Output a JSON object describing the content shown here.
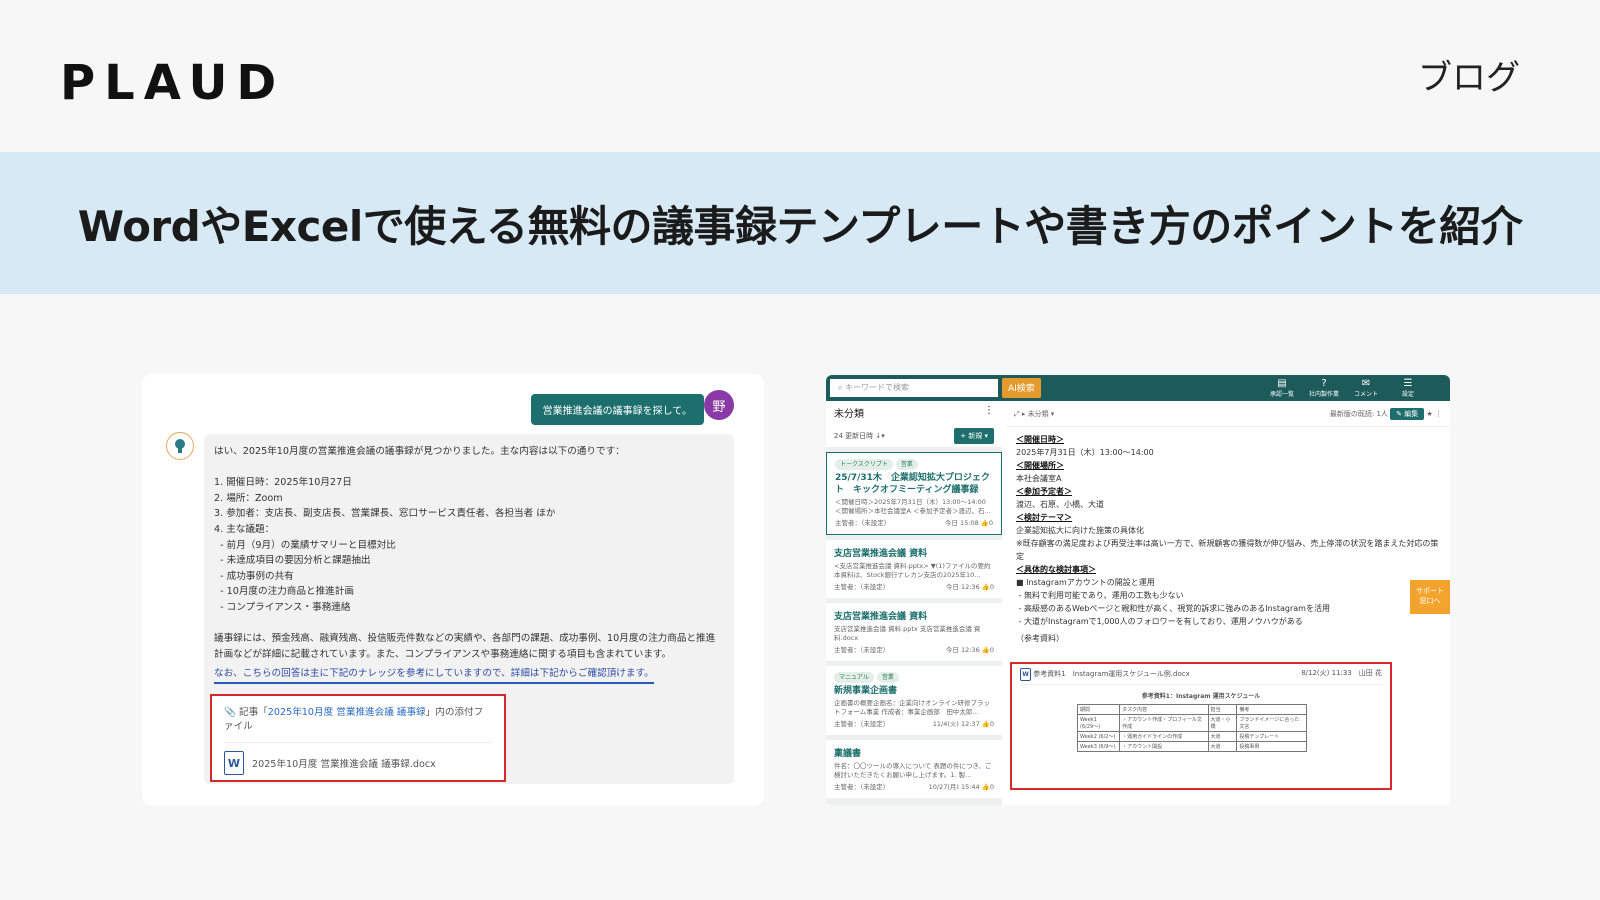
{
  "header": {
    "logo": "PLAUD",
    "nav_blog": "ブログ"
  },
  "banner": {
    "title": "WordやExcelで使える無料の議事録テンプレートや書き方のポイントを紹介"
  },
  "chat": {
    "user_message": "営業推進会議の議事録を探して。",
    "user_avatar": "野",
    "answer_text": "はい、2025年10月度の営業推進会議の議事録が見つかりました。主な内容は以下の通りです：\n\n1. 開催日時：2025年10月27日\n2. 場所：Zoom\n3. 参加者：支店長、副支店長、営業課長、窓口サービス責任者、各担当者 ほか\n4. 主な議題：\n  - 前月（9月）の業績サマリーと目標対比\n  - 未達成項目の要因分析と課題抽出\n  - 成功事例の共有\n  - 10月度の注力商品と推進計画\n  - コンプライアンス・事務連絡\n\n議事録には、預金残高、融資残高、投信販売件数などの実績や、各部門の課題、成功事例、10月度の注力商品と推進計画などが詳細に記載されています。また、コンプライアンスや事務連絡に関する項目も含まれています。",
    "note": "なお、こちらの回答は主に下記のナレッジを参考にしていますので、詳細は下記からご確認頂けます。",
    "attach_prefix": "記事「",
    "attach_link": "2025年10月度 営業推進会議 議事録",
    "attach_suffix": "」内の添付ファイル",
    "file_name": "2025年10月度 営業推進会議 議事録.docx",
    "word_icon": "W"
  },
  "app": {
    "search_placeholder": "キーワードで検索",
    "ai_search": "AI検索",
    "top_icons": [
      {
        "g": "▤",
        "l": "承認一覧"
      },
      {
        "g": "?",
        "l": "社内製作業"
      },
      {
        "g": "✉",
        "l": "コメント"
      },
      {
        "g": "☰",
        "l": "設定"
      }
    ],
    "list_title": "未分類",
    "list_count": "24  更新日時 ↓▾",
    "new_button": "+ 新規 ▾",
    "cards": [
      {
        "tags": [
          "トークスクリプト",
          "営業"
        ],
        "title": "25/7/31木　企業認知拡大プロジェクト　キックオフミーティング議事録",
        "desc": "＜開催日時＞2025年7月31日（木）13:00〜14:00 ＜開催場所＞本社会議室A ＜参加予定者＞渡辺、石…",
        "owner": "主管者：（未設定）",
        "date": "今日 15:08 👍0"
      },
      {
        "tags": [],
        "title": "支店営業推進会議 資料",
        "desc": "<支店営業推進会議 資料.pptx> ▼(1)ファイルの要約 本資料は、Stock銀行ナレカン支店の2025年10…",
        "owner": "主管者：（未設定）",
        "date": "今日 12:36 👍0"
      },
      {
        "tags": [],
        "title": "支店営業推進会議 資料",
        "desc": "支店営業推進会議 資料.pptx 支店営業推進会議 資料.docx",
        "owner": "主管者：（未設定）",
        "date": "今日 12:36 👍0"
      },
      {
        "tags": [
          "マニュアル",
          "営業"
        ],
        "title": "新規事業企画書",
        "desc": "企画書の概要企画名：企業向けオンライン研修プラットフォーム事業 作成者：事業企画部　田中太郎…",
        "owner": "主管者：（未設定）",
        "date": "11/4(火) 12:37 👍0"
      },
      {
        "tags": [],
        "title": "稟議書",
        "desc": "件名：〇〇ツールの導入について 表題の件につき、ご検討いただきたくお願い申し上げます。1. 製…",
        "owner": "主管者：（未設定）",
        "date": "10/27(月) 15:44 👍0"
      }
    ],
    "detail_folder": "▸ 未分類 ▾",
    "detail_reader": "最新版の既読: 1人",
    "edit_button": "✎ 編集",
    "detail_body": [
      {
        "h": "＜開催日時＞",
        "t": "2025年7月31日（木）13:00〜14:00"
      },
      {
        "h": "＜開催場所＞",
        "t": "本社会議室A"
      },
      {
        "h": "＜参加予定者＞",
        "t": "渡辺、石原、小橋、大道"
      },
      {
        "h": "＜検討テーマ＞",
        "t": "企業認知拡大に向けた施策の具体化\n※既存顧客の満足度および再受注率は高い一方で、新規顧客の獲得数が伸び悩み、売上停滞の状況を踏まえた対応の策定"
      },
      {
        "h": "＜具体的な検討事項＞",
        "t": "■ Instagramアカウントの開設と運用\n - 無料で利用可能であり、運用の工数も少ない\n - 高級感のあるWebページと親和性が高く、視覚的訴求に強みのあるInstagramを活用\n - 大道がInstagramで1,000人のフォロワーを有しており、運用ノウハウがある"
      }
    ],
    "ref_label": "（参考資料）",
    "support": "サポート\n窓口へ",
    "ref_file": "参考資料1　Instagram運用スケジュール例.docx",
    "ref_date": "8/12(火) 11:33　山田 花",
    "mini_title": "参考資料1：Instagram 運用スケジュール",
    "mini_rows": [
      [
        "期間",
        "タスク内容",
        "担当",
        "備考"
      ],
      [
        "Week1\n(6/29〜)",
        "・アカウント作成・プロフィール文作成",
        "大道・小橋",
        "ブランドイメージに合った文言"
      ],
      [
        "Week2\n(6/2〜)",
        "・運用ガイドラインの作成",
        "大道",
        "投稿テンプレート"
      ],
      [
        "Week3\n(6/9〜)",
        "・アカウント開設",
        "大道",
        "投稿事例"
      ]
    ]
  }
}
